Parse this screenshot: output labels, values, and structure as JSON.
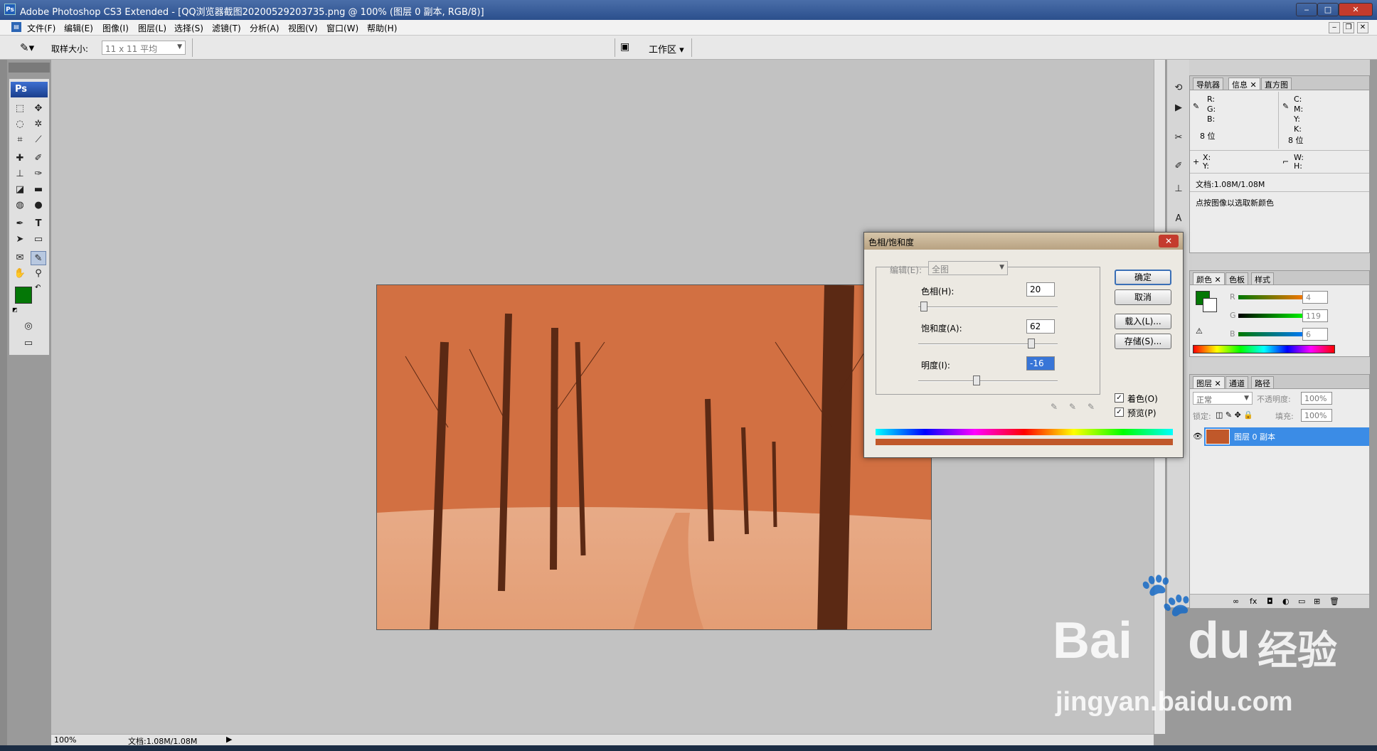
{
  "window": {
    "title": "Adobe Photoshop CS3 Extended - [QQ浏览器截图20200529203735.png @ 100% (图层 0 副本, RGB/8)]",
    "app_icon": "Ps"
  },
  "menu": [
    "文件(F)",
    "编辑(E)",
    "图像(I)",
    "图层(L)",
    "选择(S)",
    "滤镜(T)",
    "分析(A)",
    "视图(V)",
    "窗口(W)",
    "帮助(H)"
  ],
  "options_bar": {
    "sample_label": "取样大小:",
    "sample_value": "11 x 11 平均",
    "workspace_label": "工作区"
  },
  "toolbox": {
    "logo": "Ps"
  },
  "status": {
    "zoom": "100%",
    "doc": "文档:1.08M/1.08M"
  },
  "info_panel": {
    "tabs": [
      "导航器",
      "信息",
      "直方图"
    ],
    "rgb": [
      "R:",
      "G:",
      "B:"
    ],
    "cmyk": [
      "C:",
      "M:",
      "Y:",
      "K:"
    ],
    "bits_left": "8 位",
    "bits_right": "8 位",
    "xy": [
      "X:",
      "Y:"
    ],
    "wh": [
      "W:",
      "H:"
    ],
    "doc": "文档:1.08M/1.08M",
    "hint": "点按图像以选取新颜色"
  },
  "color_panel": {
    "tabs": [
      "颜色",
      "色板",
      "样式"
    ],
    "r_label": "R",
    "g_label": "G",
    "b_label": "B",
    "r": "4",
    "g": "119",
    "b": "6",
    "fg_color": "#047706"
  },
  "layers_panel": {
    "tabs": [
      "图层",
      "通道",
      "路径"
    ],
    "blend_mode": "正常",
    "opacity_label": "不透明度:",
    "opacity": "100%",
    "lock_label": "锁定:",
    "fill_label": "填充:",
    "fill": "100%",
    "layer_name": "图层 0 副本"
  },
  "dialog": {
    "title": "色相/饱和度",
    "edit_label": "编辑(E):",
    "edit_value": "全图",
    "hue_label": "色相(H):",
    "hue": "20",
    "hue_level": 0.04,
    "sat_label": "饱和度(A):",
    "sat": "62",
    "sat_level": 0.81,
    "light_label": "明度(I):",
    "light": "-16",
    "light_level": 0.42,
    "ok": "确定",
    "cancel": "取消",
    "load": "载入(L)...",
    "save": "存储(S)...",
    "colorize_label": "着色(O)",
    "preview_label": "预览(P)",
    "colorize_checked": true,
    "preview_checked": true,
    "tint_color": "#c0582a"
  },
  "watermark": {
    "brand": "Bai",
    "brand2": "du",
    "cn": "经验",
    "url": "jingyan.baidu.com"
  }
}
